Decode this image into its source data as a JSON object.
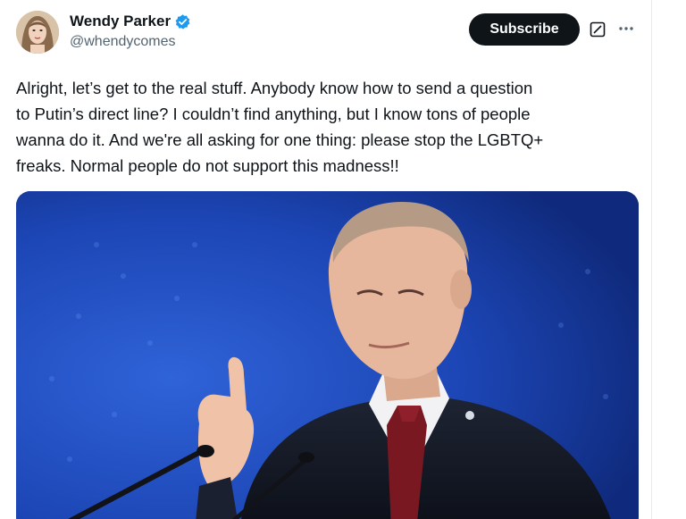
{
  "author": {
    "display_name": "Wendy Parker",
    "handle": "@whendycomes",
    "verified": true
  },
  "actions": {
    "subscribe_label": "Subscribe",
    "grok_icon": "grok-icon",
    "more_icon": "more-icon"
  },
  "tweet": {
    "text": "Alright, let’s get to the real stuff. Anybody know how to send a question\nto Putin’s direct line? I couldn’t find anything, but I know tons of people\nwanna do it. And we're all asking for one thing: please stop the LGBTQ+\nfreaks. Normal people do not support this madness!!"
  },
  "colors": {
    "verified_badge": "#1d9bf0",
    "subscribe_bg": "#0f1419",
    "handle_text": "#536471",
    "media_bg": "#1b3f9e"
  }
}
